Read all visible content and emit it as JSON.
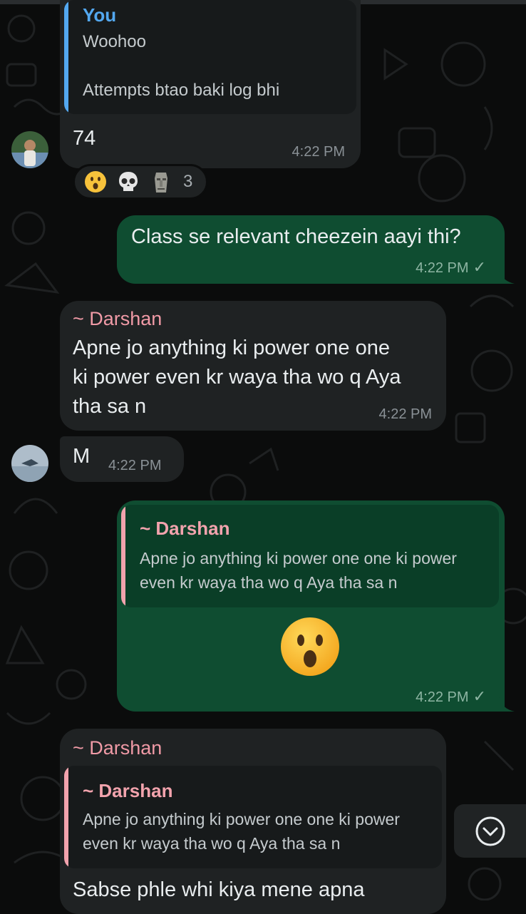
{
  "messages": {
    "m1": {
      "reply_to_author": "You",
      "reply_to_lines": [
        "Woohoo",
        "Attempts btao baki log bhi"
      ],
      "text": "74",
      "time": "4:22 PM",
      "reactions": {
        "emojis": [
          "astonished-face",
          "skull",
          "moai"
        ],
        "count": "3"
      }
    },
    "m2": {
      "text": "Class se relevant cheezein aayi thi?",
      "time": "4:22 PM",
      "status": "✓"
    },
    "m3": {
      "sender": "~ Darshan",
      "lines": [
        "Apne jo anything ki power one one",
        "ki power even kr waya tha wo q Aya",
        "tha sa n"
      ],
      "time": "4:22 PM"
    },
    "m4": {
      "text": "M",
      "time": "4:22 PM"
    },
    "m5": {
      "reply_to_author": "~ Darshan",
      "reply_to_lines": [
        "Apne jo anything ki power one one ki power",
        "even kr waya tha wo q Aya tha sa n"
      ],
      "emoji": "astonished-face",
      "time": "4:22 PM",
      "status": "✓"
    },
    "m6": {
      "sender": "~ Darshan",
      "reply_to_author": "~ Darshan",
      "reply_to_lines": [
        "Apne jo anything ki power one one ki power",
        "even kr waya tha wo q Aya tha sa n"
      ],
      "text": "Sabse phle whi kiya mene apna"
    }
  },
  "scroll_button": {
    "icon": "chevron-down-icon"
  },
  "colors": {
    "background": "#0b0c0c",
    "incoming_bubble": "#1f2223",
    "outgoing_bubble": "#0f4d31",
    "you_name": "#53a8f0",
    "contact_name": "#f09aa6"
  }
}
